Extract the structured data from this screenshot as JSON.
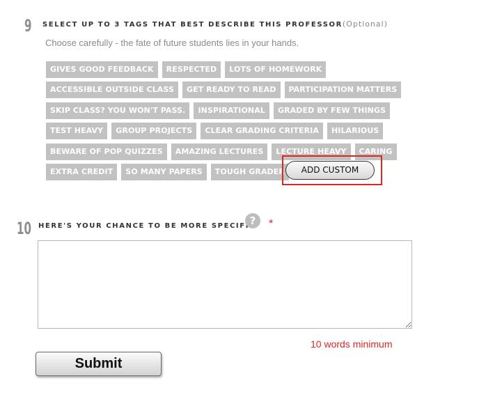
{
  "question9": {
    "number": "9",
    "title": "SELECT UP TO 3 TAGS THAT BEST DESCRIBE THIS PROFESSOR",
    "optional": "(Optional)",
    "subtext": "Choose carefully - the fate of future students lies in your hands.",
    "tag_rows": [
      [
        "GIVES GOOD FEEDBACK",
        "RESPECTED",
        "LOTS OF HOMEWORK"
      ],
      [
        "ACCESSIBLE OUTSIDE CLASS",
        "GET READY TO READ",
        "PARTICIPATION MATTERS"
      ],
      [
        "SKIP CLASS? YOU WON'T PASS.",
        "INSPIRATIONAL",
        "GRADED BY FEW THINGS"
      ],
      [
        "TEST HEAVY",
        "GROUP PROJECTS",
        "CLEAR GRADING CRITERIA",
        "HILARIOUS"
      ],
      [
        "BEWARE OF POP QUIZZES",
        "AMAZING LECTURES",
        "LECTURE HEAVY",
        "CARING"
      ],
      [
        "EXTRA CREDIT",
        "SO MANY PAPERS",
        "TOUGH GRADER"
      ]
    ],
    "add_custom_label": "ADD CUSTOM"
  },
  "question10": {
    "number": "10",
    "title": "HERE'S YOUR CHANCE TO BE MORE SPECIFIC",
    "help_icon": "question-mark-circle",
    "required_mark": "*",
    "comment_value": "",
    "minimum_note": "10 words minimum"
  },
  "submit_label": "Submit",
  "colors": {
    "tag_bg": "#c2c2c2",
    "highlight_red": "#e02424",
    "number_gray": "#8e8e8e"
  }
}
